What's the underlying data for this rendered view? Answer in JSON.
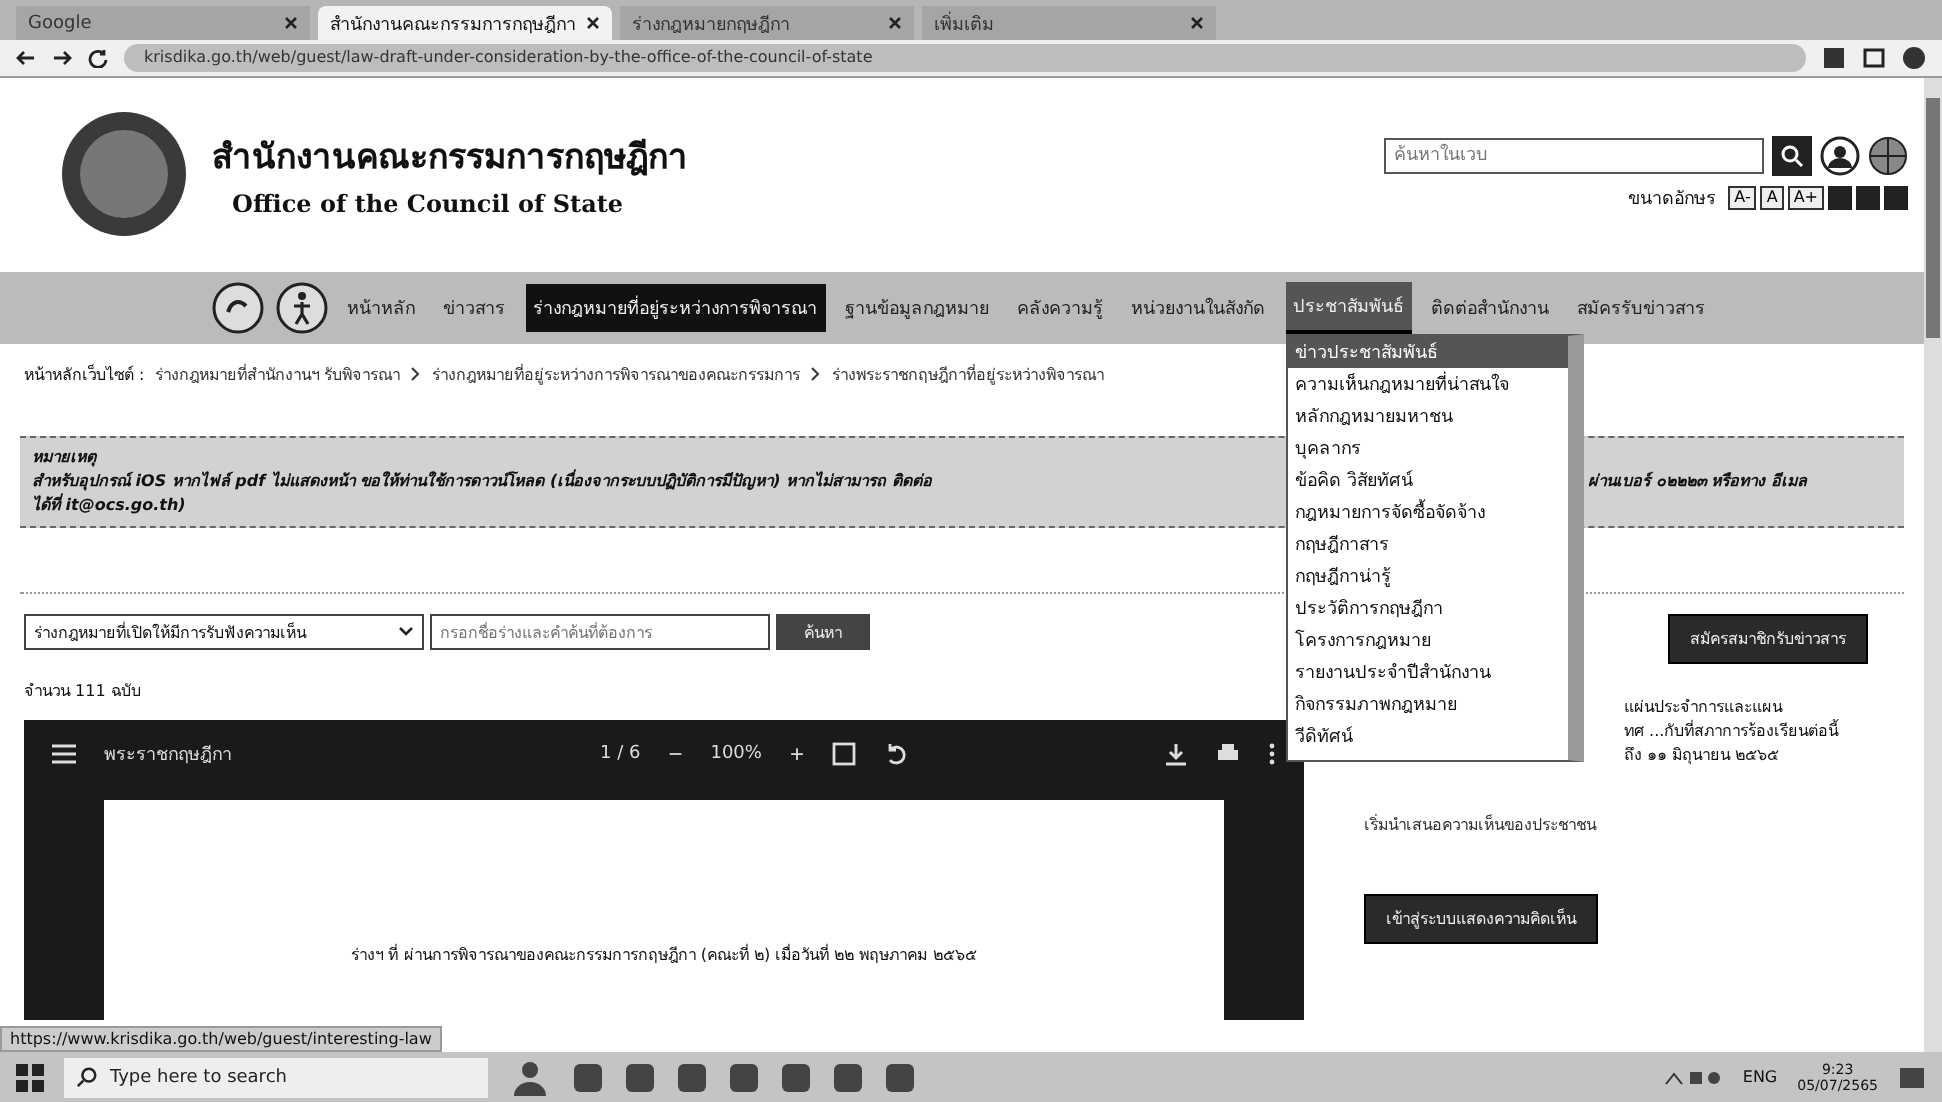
{
  "browser": {
    "tabs": [
      {
        "label": "Google",
        "selected": false
      },
      {
        "label": "สำนักงานคณะกรรมการกฤษฎีกา",
        "selected": true
      },
      {
        "label": "ร่างกฎหมายกฤษฎีกา",
        "selected": false
      },
      {
        "label": "เพิ่มเติม",
        "selected": false
      }
    ],
    "url": "krisdika.go.th/web/guest/law-draft-under-consideration-by-the-office-of-the-council-of-state"
  },
  "header": {
    "title": "สำนักงานคณะกรรมการกฤษฎีกา",
    "subtitle": "Office of the Council of State",
    "search": {
      "placeholder": "ค้นหาในเวบ"
    },
    "font_size_label": "ขนาดอักษร",
    "font_buttons": [
      "A-",
      "A",
      "A+"
    ]
  },
  "nav": {
    "items": [
      {
        "label": "หน้าหลัก",
        "selected": false,
        "expanded": false
      },
      {
        "label": "ข่าวสาร",
        "selected": false,
        "expanded": false
      },
      {
        "label": "ร่างกฎหมายที่อยู่ระหว่างการพิจารณา",
        "selected": true,
        "expanded": false
      },
      {
        "label": "ฐานข้อมูลกฎหมาย",
        "selected": false,
        "expanded": false
      },
      {
        "label": "คลังความรู้",
        "selected": false,
        "expanded": false
      },
      {
        "label": "หน่วยงานในสังกัด",
        "selected": false,
        "expanded": false
      },
      {
        "label": "ประชาสัมพันธ์",
        "selected": false,
        "expanded": true
      },
      {
        "label": "ติดต่อสำนักงาน",
        "selected": false,
        "expanded": false
      },
      {
        "label": "สมัครรับข่าวสาร",
        "selected": false,
        "expanded": false
      }
    ],
    "dropdown": [
      {
        "label": "ข่าวประชาสัมพันธ์",
        "selected": true
      },
      {
        "label": "ความเห็นกฎหมายที่น่าสนใจ",
        "selected": false
      },
      {
        "label": "หลักกฎหมายมหาชน",
        "selected": false
      },
      {
        "label": "บุคลากร",
        "selected": false
      },
      {
        "label": "ข้อคิด วิสัยทัศน์",
        "selected": false
      },
      {
        "label": "กฎหมายการจัดซื้อจัดจ้าง",
        "selected": false
      },
      {
        "label": "กฤษฎีกาสาร",
        "selected": false
      },
      {
        "label": "กฤษฎีกาน่ารู้",
        "selected": false
      },
      {
        "label": "ประวัติการกฤษฎีกา",
        "selected": false
      },
      {
        "label": "โครงการกฎหมาย",
        "selected": false
      },
      {
        "label": "รายงานประจำปีสำนักงาน",
        "selected": false
      },
      {
        "label": "กิจกรรมภาพกฎหมาย",
        "selected": false
      },
      {
        "label": "วีดิทัศน์",
        "selected": false
      }
    ]
  },
  "breadcrumb": [
    "หน้าหลักเว็บไซต์ :",
    "ร่างกฎหมายที่สำนักงานฯ รับพิจารณา",
    "ร่างกฎหมายที่อยู่ระหว่างการพิจารณาของคณะกรรมการ",
    "ร่างพระราชกฤษฎีกาที่อยู่ระหว่างพิจารณา"
  ],
  "notice": {
    "heading": "หมายเหตุ",
    "body": "สำหรับอุปกรณ์ iOS หากไฟล์ pdf ไม่แสดงหน้า ขอให้ท่านใช้การดาวน์โหลด (เนื่องจากระบบปฏิบัติการมีปัญหา) หากไม่สามารถ ติดต่อ",
    "body_end": "ผ่านเบอร์ ๐๒๒๒๓ หรือทาง อีเมล",
    "contact": "ได้ที่ it@ocs.go.th)"
  },
  "filters": {
    "category": "ร่างกฎหมายที่เปิดให้มีการรับฟังความเห็น",
    "query": {
      "placeholder": "กรอกชื่อร่างและคำค้นที่ต้องการ"
    },
    "button": "ค้นหา"
  },
  "count": "จำนวน 111 ฉบับ",
  "pdf_viewer": {
    "title": "พระราชกฤษฎีกา",
    "page": "1 / 6",
    "minus": "−",
    "zoom": "100%",
    "plus": "+",
    "caption": "ร่างฯ ที่ ผ่านการพิจารณาของคณะกรรมการกฤษฎีกา (คณะที่ ๒) เมื่อวันที่ ๒๒ พฤษภาคม ๒๕๖๕"
  },
  "side": {
    "subscribe_button": "สมัครสมาชิกรับข่าวสาร",
    "lines": [
      "แผ่นประจำการและแผน",
      "ทศ ...กับที่สภาการร้องเรียนต่อนี้",
      "ถึง ๑๑ มิถุนายน ๒๕๖๕"
    ],
    "link": "เริ่มนำเสนอความเห็นของประชาชน",
    "login_button": "เข้าสู่ระบบแสดงความคิดเห็น"
  },
  "status_url": "https://www.krisdika.go.th/web/guest/interesting-law",
  "taskbar": {
    "search": {
      "placeholder": "Type here to search"
    },
    "language": "ENG",
    "time": "9:23",
    "date": "05/07/2565"
  }
}
